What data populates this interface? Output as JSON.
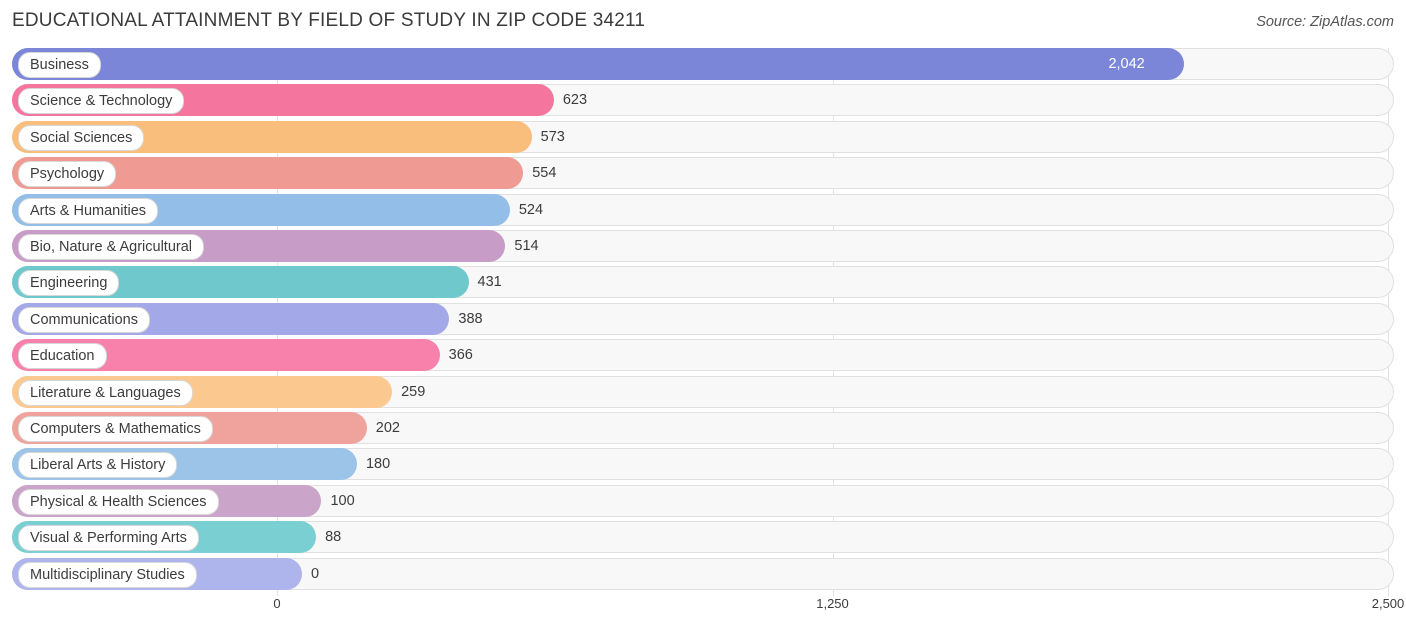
{
  "header": {
    "title": "EDUCATIONAL ATTAINMENT BY FIELD OF STUDY IN ZIP CODE 34211",
    "source": "Source: ZipAtlas.com"
  },
  "chart_data": {
    "type": "bar",
    "orientation": "horizontal",
    "title": "EDUCATIONAL ATTAINMENT BY FIELD OF STUDY IN ZIP CODE 34211",
    "xlabel": "",
    "ylabel": "",
    "xlim": [
      0,
      2500
    ],
    "grid": true,
    "ticks": [
      "0",
      "1,250",
      "2,500"
    ],
    "tick_values": [
      0,
      1250,
      2500
    ],
    "categories": [
      "Business",
      "Science & Technology",
      "Social Sciences",
      "Psychology",
      "Arts & Humanities",
      "Bio, Nature & Agricultural",
      "Engineering",
      "Communications",
      "Education",
      "Literature & Languages",
      "Computers & Mathematics",
      "Liberal Arts & History",
      "Physical & Health Sciences",
      "Visual & Performing Arts",
      "Multidisciplinary Studies"
    ],
    "values": [
      2042,
      623,
      573,
      554,
      524,
      514,
      431,
      388,
      366,
      259,
      202,
      180,
      100,
      88,
      0
    ],
    "labels": [
      "2,042",
      "623",
      "573",
      "554",
      "524",
      "514",
      "431",
      "388",
      "366",
      "259",
      "202",
      "180",
      "100",
      "88",
      "0"
    ],
    "colors": [
      "#7b86d8",
      "#f4769f",
      "#f9bd7c",
      "#ef9a92",
      "#93bee8",
      "#c79cc6",
      "#6fc9cc",
      "#a3a9e8",
      "#f781ab",
      "#fbc98f",
      "#f0a39c",
      "#9cc3e8",
      "#caa4c9",
      "#79cfd1",
      "#aeb4ec"
    ],
    "label_inside": [
      true,
      false,
      false,
      false,
      false,
      false,
      false,
      false,
      false,
      false,
      false,
      false,
      false,
      false,
      false
    ]
  }
}
